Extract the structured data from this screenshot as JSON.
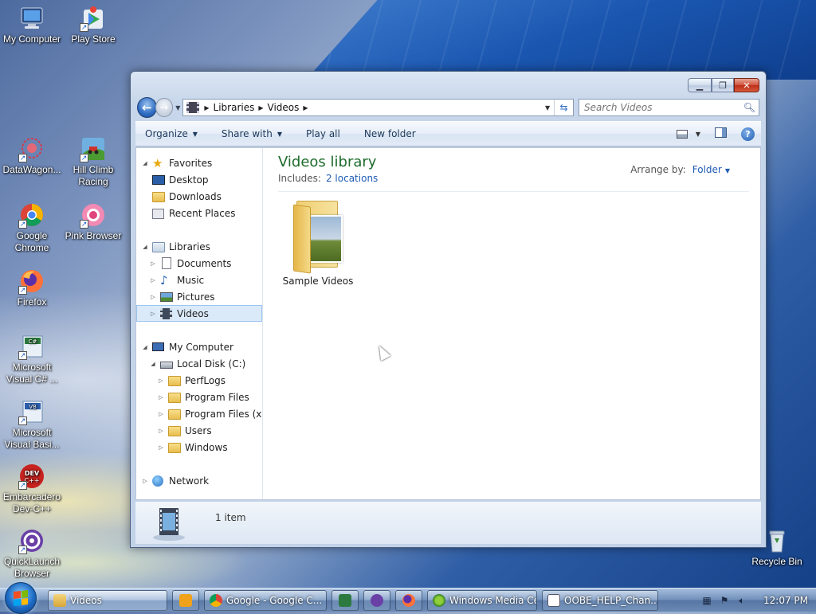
{
  "desktop": {
    "icons": [
      {
        "label": "My Computer"
      },
      {
        "label": "Play Store"
      },
      {
        "label": "DataWagon..."
      },
      {
        "label": "Hill Climb Racing"
      },
      {
        "label": "Google Chrome"
      },
      {
        "label": "Pink Browser"
      },
      {
        "label": "Firefox"
      },
      {
        "label": "Microsoft Visual C# ..."
      },
      {
        "label": "Microsoft Visual Basi..."
      },
      {
        "label": "Embarcadero Dev-C++"
      },
      {
        "label": "QuickLaunch Browser"
      },
      {
        "label": "Recycle Bin"
      }
    ]
  },
  "window": {
    "title": "Videos",
    "breadcrumb": [
      "Libraries",
      "Videos"
    ],
    "search": {
      "placeholder": "Search Videos"
    },
    "toolbar": {
      "organize": "Organize",
      "share_with": "Share with",
      "play_all": "Play all",
      "new_folder": "New folder"
    },
    "nav": {
      "favorites": "Favorites",
      "desktop": "Desktop",
      "downloads": "Downloads",
      "recent_places": "Recent Places",
      "libraries": "Libraries",
      "documents": "Documents",
      "music": "Music",
      "pictures": "Pictures",
      "videos": "Videos",
      "my_computer": "My Computer",
      "local_disk": "Local Disk (C:)",
      "perflogs": "PerfLogs",
      "program_files": "Program Files",
      "program_files_x86": "Program Files (x86",
      "users": "Users",
      "windows": "Windows",
      "network": "Network"
    },
    "content": {
      "library_title": "Videos library",
      "includes_label": "Includes:",
      "includes_link": "2 locations",
      "arrange_label": "Arrange by:",
      "arrange_value": "Folder",
      "items": [
        {
          "name": "Sample Videos"
        }
      ]
    },
    "details": {
      "count": "1 item"
    }
  },
  "taskbar": {
    "buttons": [
      {
        "label": "Videos"
      },
      {
        "label": "Google - Google C..."
      },
      {
        "label": "Windows Media Ce..."
      },
      {
        "label": "OOBE_HELP_Chan..."
      }
    ],
    "clock": "12:07 PM"
  }
}
